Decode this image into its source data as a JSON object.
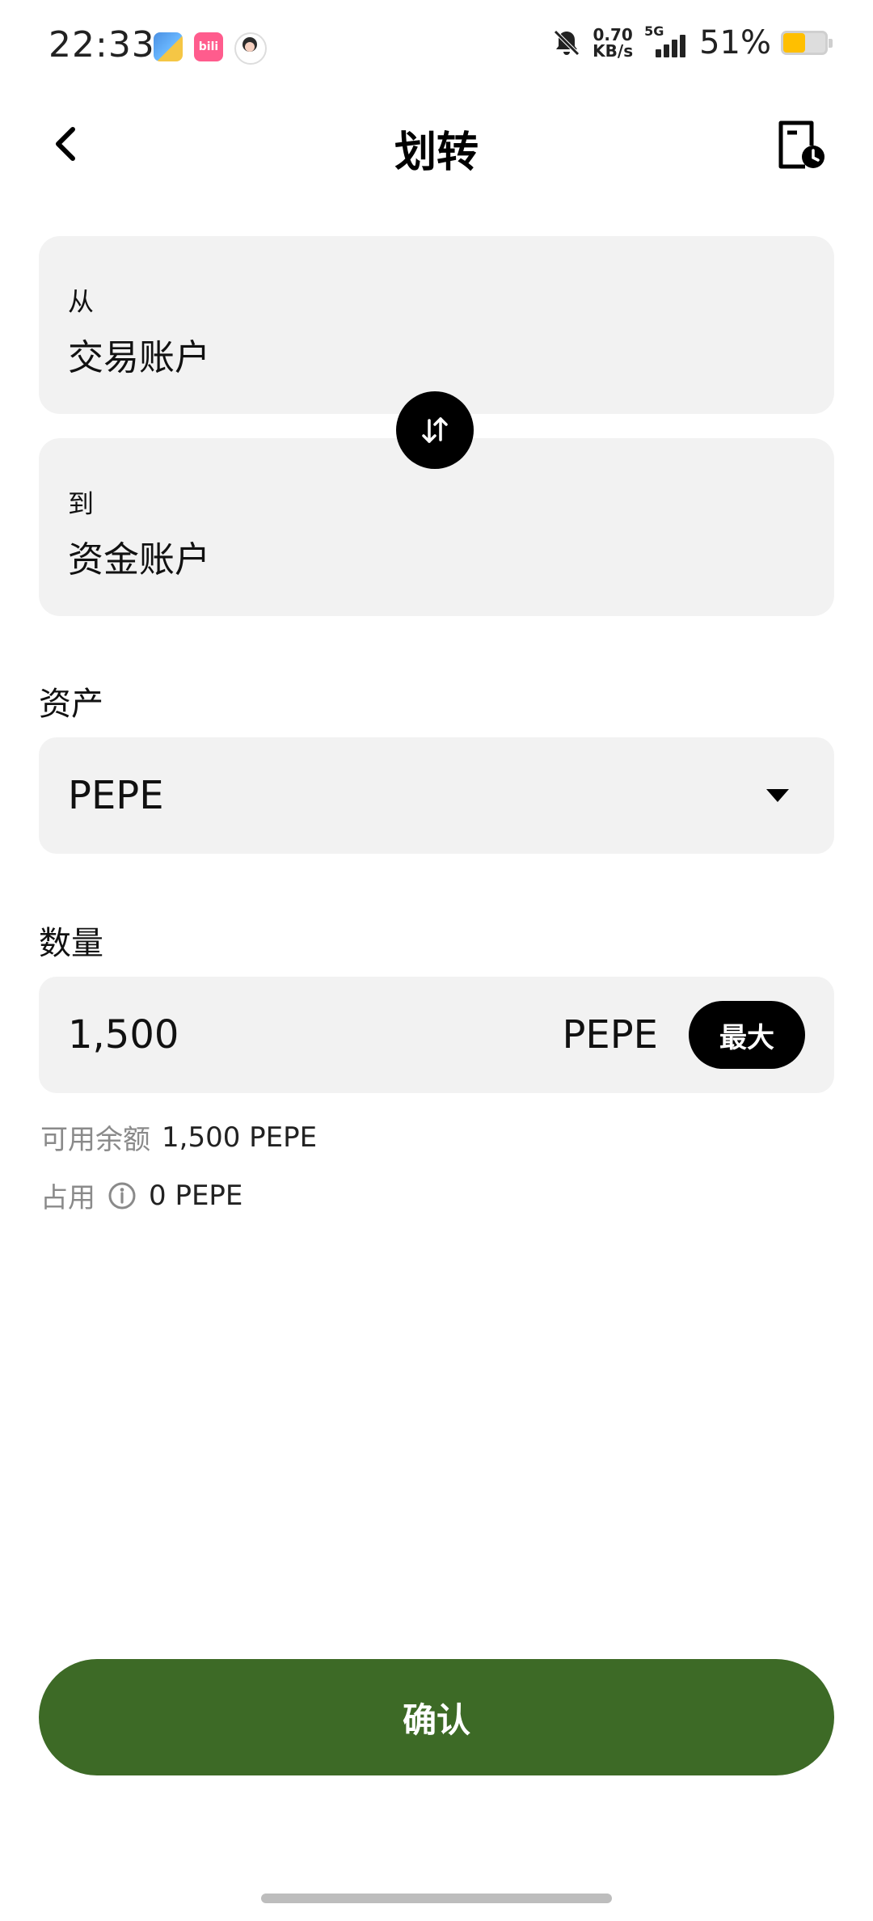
{
  "status_bar": {
    "time": "22:33",
    "net_speed_value": "0.70",
    "net_speed_unit": "KB/s",
    "network": "5G",
    "battery_percent": "51%",
    "battery_level": 0.51,
    "app_icons": [
      "files-app-icon",
      "bilibili-icon",
      "avatar-app-icon"
    ],
    "bili_text": "bili"
  },
  "header": {
    "title": "划转",
    "back_icon": "chevron-left-icon",
    "history_icon": "record-history-icon"
  },
  "transfer": {
    "from_label": "从",
    "from_account": "交易账户",
    "to_label": "到",
    "to_account": "资金账户",
    "swap_icon": "swap-arrows-icon"
  },
  "asset": {
    "label": "资产",
    "selected": "PEPE"
  },
  "quantity": {
    "label": "数量",
    "value": "1,500",
    "unit": "PEPE",
    "max_label": "最大"
  },
  "balance": {
    "available_label": "可用余额",
    "available_value": "1,500 PEPE",
    "occupied_label": "占用",
    "occupied_value": "0 PEPE"
  },
  "confirm_label": "确认",
  "colors": {
    "confirm_bg": "#3d6a26",
    "field_bg": "#f2f2f2",
    "battery_fill": "#ffbf00"
  }
}
